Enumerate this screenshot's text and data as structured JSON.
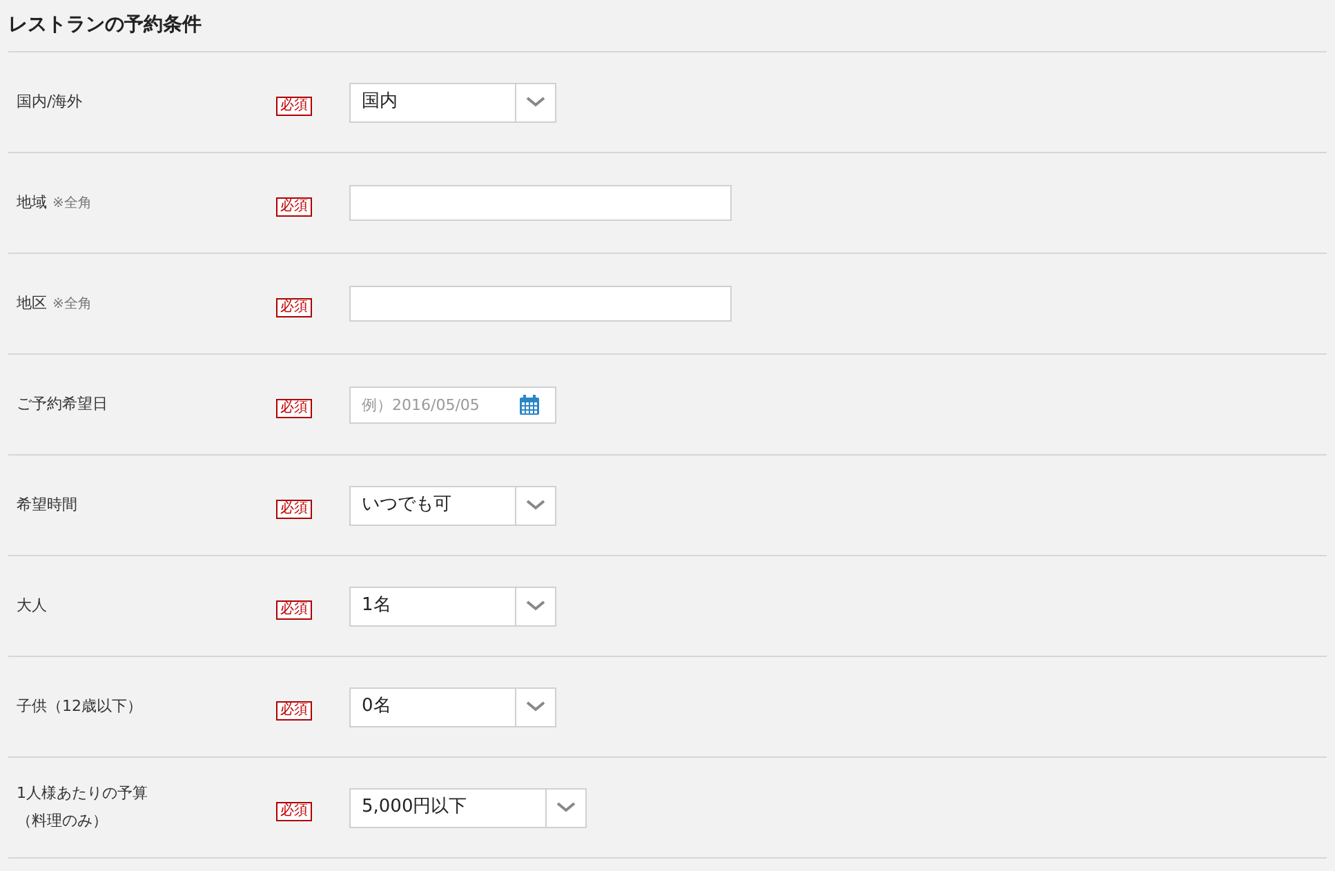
{
  "title": "レストランの予約条件",
  "rows": [
    {
      "label": [
        "国内/海外"
      ],
      "badge": "必須",
      "kind": "select",
      "value": "国内"
    },
    {
      "label": [
        "地域"
      ],
      "note": "※全角",
      "badge": "必須",
      "kind": "text"
    },
    {
      "label": [
        "地区"
      ],
      "note": "※全角",
      "badge": "必須",
      "kind": "text"
    },
    {
      "label": [
        "ご予約希望日"
      ],
      "badge": "必須",
      "kind": "date",
      "placeholder": "例）2016/05/05"
    },
    {
      "label": [
        "希望時間"
      ],
      "badge": "必須",
      "kind": "select",
      "value": "いつでも可"
    },
    {
      "label": [
        "大人"
      ],
      "badge": "必須",
      "kind": "select",
      "value": "1名"
    },
    {
      "label": [
        "子供（12歳以下）"
      ],
      "badge": "必須",
      "kind": "select",
      "value": "0名"
    },
    {
      "label": [
        "1人様あたりの予算",
        "（料理のみ）"
      ],
      "badge": "必須",
      "kind": "select",
      "value": "5,000円以下"
    }
  ]
}
